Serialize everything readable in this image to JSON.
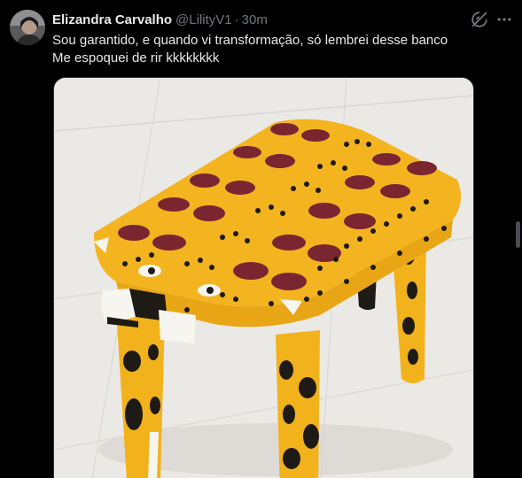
{
  "tweet": {
    "display_name": "Elizandra Carvalho",
    "handle": "@LilityV1",
    "separator": "·",
    "time": "30m",
    "text_lines": [
      "Sou garantido, e quando vi transformação, só lembrei desse banco",
      "Me espoquei de rir kkkkkkkk"
    ]
  },
  "icons": {
    "grok": "grok-icon",
    "more": "more-options-icon"
  },
  "colors": {
    "background": "#000000",
    "primary_text": "#e7e9ea",
    "secondary_text": "#71767b",
    "stool_yellow": "#f2b21c",
    "spot_maroon": "#7a2630"
  },
  "media": {
    "description_icon": "jaguar-stool-photo"
  }
}
